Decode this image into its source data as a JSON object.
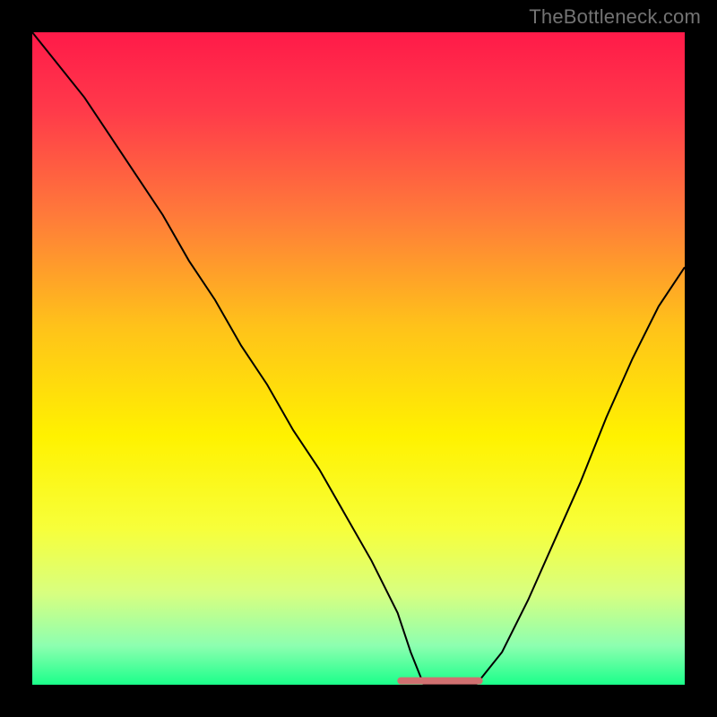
{
  "watermark": "TheBottleneck.com",
  "chart_data": {
    "type": "line",
    "title": "",
    "xlabel": "",
    "ylabel": "",
    "xlim": [
      0,
      100
    ],
    "ylim": [
      0,
      100
    ],
    "background": {
      "type": "vertical-gradient",
      "stops": [
        {
          "offset": 0.0,
          "color": "#ff1a49"
        },
        {
          "offset": 0.12,
          "color": "#ff3a4a"
        },
        {
          "offset": 0.28,
          "color": "#ff7a3a"
        },
        {
          "offset": 0.45,
          "color": "#ffc21a"
        },
        {
          "offset": 0.62,
          "color": "#fff200"
        },
        {
          "offset": 0.76,
          "color": "#f7ff3a"
        },
        {
          "offset": 0.86,
          "color": "#d8ff80"
        },
        {
          "offset": 0.94,
          "color": "#8dffb0"
        },
        {
          "offset": 1.0,
          "color": "#1bff8a"
        }
      ]
    },
    "series": [
      {
        "name": "curve",
        "stroke": "#000000",
        "stroke_width": 2,
        "x": [
          0,
          4,
          8,
          12,
          16,
          20,
          24,
          28,
          32,
          36,
          40,
          44,
          48,
          52,
          56,
          58,
          60,
          62,
          66,
          68,
          72,
          76,
          80,
          84,
          88,
          92,
          96,
          100
        ],
        "y": [
          100,
          95,
          90,
          84,
          78,
          72,
          65,
          59,
          52,
          46,
          39,
          33,
          26,
          19,
          11,
          5,
          0,
          0,
          0,
          0,
          5,
          13,
          22,
          31,
          41,
          50,
          58,
          64
        ]
      },
      {
        "name": "marker-segment",
        "stroke": "#d07070",
        "stroke_width": 8,
        "x": [
          56.5,
          68.5
        ],
        "y": [
          0.6,
          0.6
        ]
      }
    ],
    "annotations": []
  }
}
